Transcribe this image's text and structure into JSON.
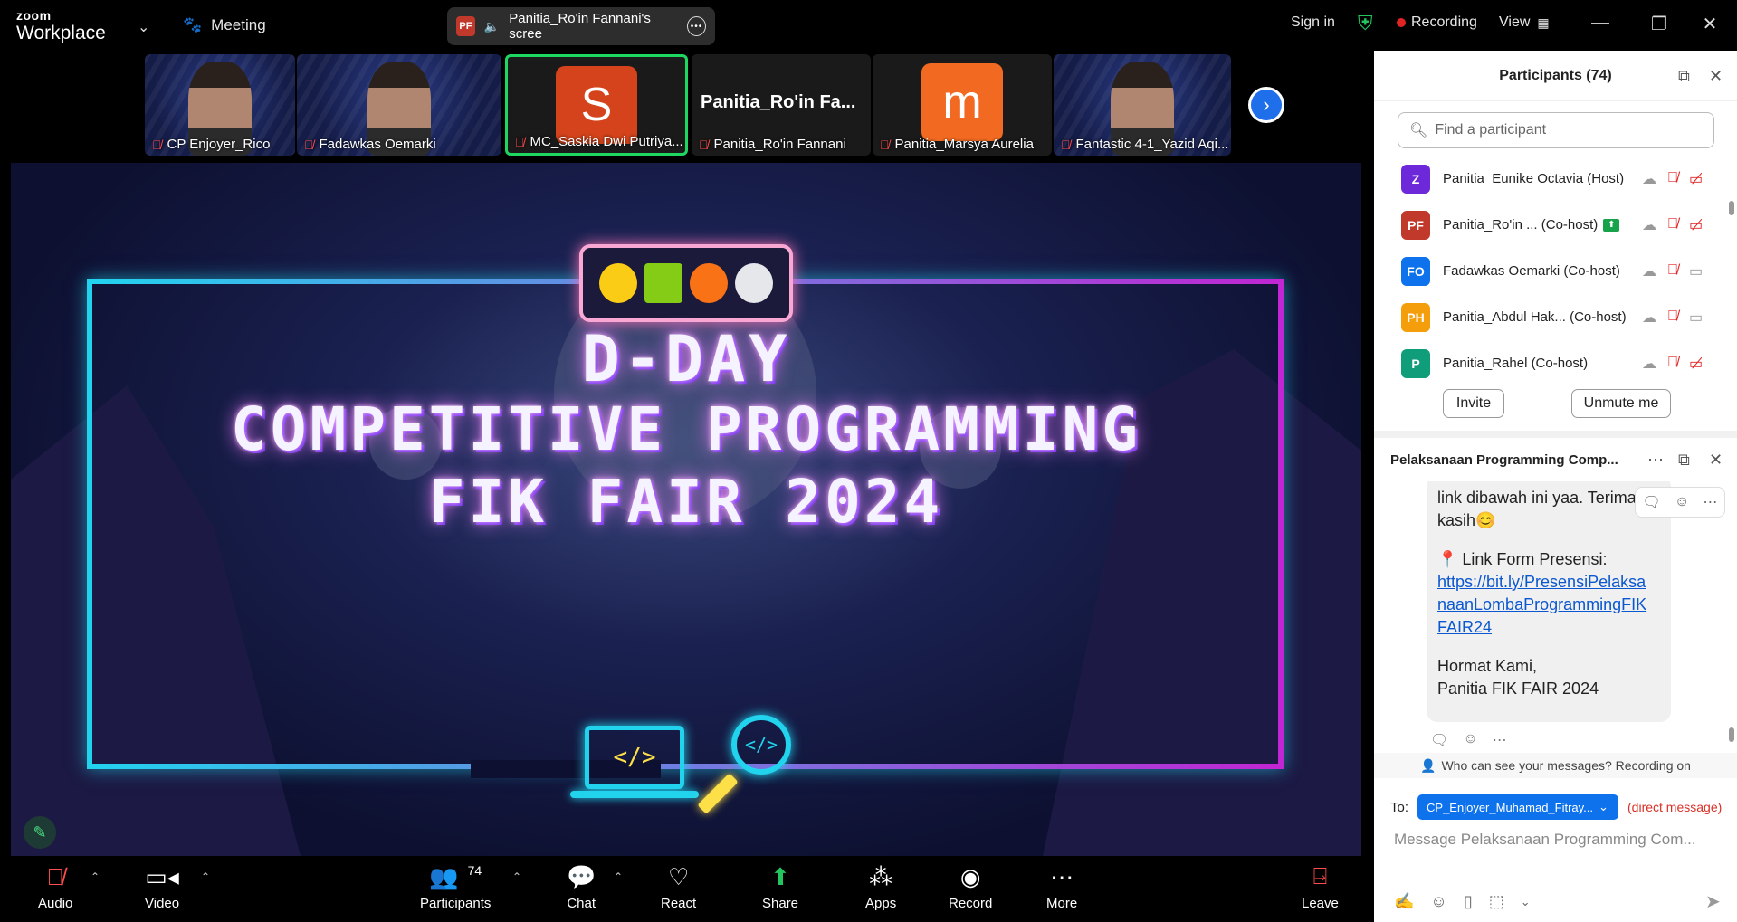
{
  "topbar": {
    "brand_small": "zoom",
    "brand_large": "Workplace",
    "meeting_label": "Meeting",
    "share_badge": "PF",
    "share_title": "Panitia_Ro'in Fannani's scree",
    "sign_in": "Sign in",
    "recording": "Recording",
    "view": "View"
  },
  "gallery": {
    "tiles": [
      {
        "name": "CP Enjoyer_Rico"
      },
      {
        "name": "Fadawkas Oemarki"
      },
      {
        "name": "MC_Saskia Dwi Putriya...",
        "avatar_letter": "S",
        "avatar_color": "#d4431b"
      },
      {
        "name": "Panitia_Ro'in Fannani",
        "title": "Panitia_Ro'in  Fa..."
      },
      {
        "name": "Panitia_Marsya Aurelia",
        "avatar_letter": "m",
        "avatar_color": "#f26a21"
      },
      {
        "name": "Fantastic 4-1_Yazid Aqi..."
      }
    ]
  },
  "stage": {
    "line1": "D-DAY",
    "line2": "COMPETITIVE PROGRAMMING",
    "line3": "FIK FAIR 2024",
    "code_glyph": "</>"
  },
  "toolbar": {
    "audio": "Audio",
    "video": "Video",
    "participants": "Participants",
    "participants_count": "74",
    "chat": "Chat",
    "react": "React",
    "share": "Share",
    "apps": "Apps",
    "record": "Record",
    "more": "More",
    "leave": "Leave"
  },
  "participants_panel": {
    "title": "Participants (74)",
    "search_placeholder": "Find a participant",
    "rows": [
      {
        "initials": "Z",
        "color": "#6d28d9",
        "name": "Panitia_Eunike Octavia (Host)"
      },
      {
        "initials": "PF",
        "color": "#c0392b",
        "name": "Panitia_Ro'in ...  (Co-host)"
      },
      {
        "initials": "FO",
        "color": "#0e72ed",
        "name": "Fadawkas Oemarki (Co-host)"
      },
      {
        "initials": "PH",
        "color": "#f59e0b",
        "name": "Panitia_Abdul Hak...  (Co-host)"
      },
      {
        "initials": "P",
        "color": "#0f9d7a",
        "name": "Panitia_Rahel (Co-host)"
      }
    ],
    "invite": "Invite",
    "unmute": "Unmute me"
  },
  "chat_panel": {
    "title": "Pelaksanaan Programming Comp...",
    "message": {
      "line1": "link dibawah ini yaa. Terima",
      "line2": "kasih😊",
      "link_label": "📍 Link Form Presensi:",
      "link1": "https://bit.ly/PresensiPelaksa",
      "link2": "naanLombaProgrammingFIK",
      "link3": "FAIR24",
      "sign1": "Hormat Kami,",
      "sign2": "Panitia FIK FAIR 2024"
    },
    "privacy": "Who can see your messages? Recording on",
    "to_label": "To:",
    "to_value": "CP_Enjoyer_Muhamad_Fitray...",
    "direct": "(direct message)",
    "input_placeholder": "Message Pelaksanaan Programming Com..."
  }
}
